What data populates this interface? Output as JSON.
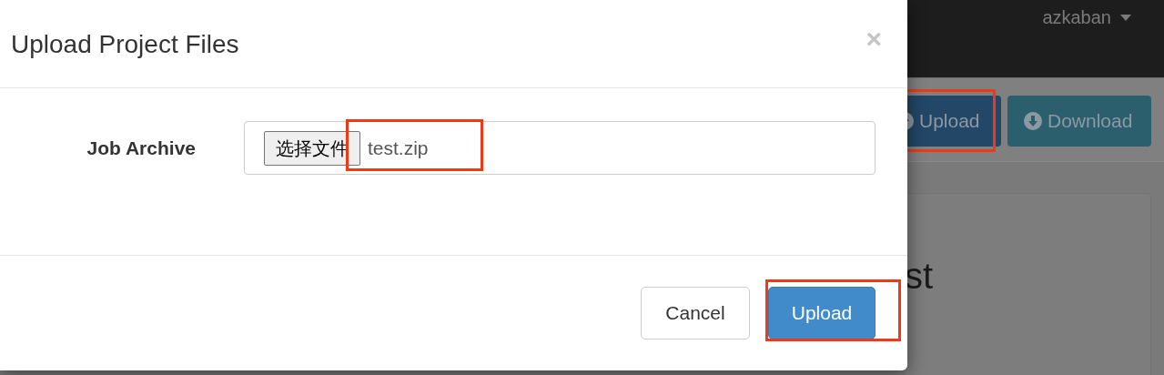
{
  "navbar": {
    "user_menu": "azkaban"
  },
  "toolbar": {
    "buttons": [
      {
        "label": "Upload",
        "kind": "primary",
        "highlighted": true
      },
      {
        "label": "Download",
        "kind": "info",
        "highlighted": false
      }
    ]
  },
  "background_panel": {
    "title_fragment": "st"
  },
  "modal": {
    "title": "Upload Project Files",
    "close": "×",
    "field": {
      "label": "Job Archive",
      "choose_button": "选择文件",
      "file_name": "test.zip",
      "highlighted": true
    },
    "buttons": [
      {
        "label": "Cancel",
        "kind": "default",
        "highlighted": false
      },
      {
        "label": "Upload",
        "kind": "primary",
        "highlighted": true
      }
    ]
  }
}
